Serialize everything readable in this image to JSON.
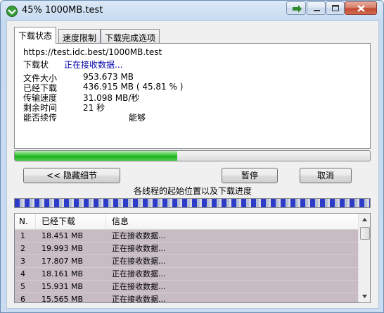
{
  "window": {
    "title": "45% 1000MB.test"
  },
  "tabs": [
    {
      "label": "下载状态"
    },
    {
      "label": "速度限制"
    },
    {
      "label": "下载完成选项"
    }
  ],
  "status_panel": {
    "url": "https://test.idc.best/1000MB.test",
    "status_label": "下载状",
    "status_value": "正在接收数据...",
    "rows": [
      {
        "label": "文件大小",
        "value": "953.673  MB"
      },
      {
        "label": "已经下载",
        "value": "436.915  MB  ( 45.81 % )"
      },
      {
        "label": "传输速度",
        "value": "31.098  MB/秒"
      },
      {
        "label": "剩余时间",
        "value": "21 秒"
      },
      {
        "label": "能否续传",
        "value": "能够"
      }
    ]
  },
  "progress": {
    "percent": 45.81
  },
  "buttons": {
    "hide_details": "<< 隐藏细节",
    "pause": "暂停",
    "cancel": "取消"
  },
  "threads_label": "各线程的起始位置以及下载进度",
  "thread_list": {
    "columns": [
      "N.",
      "已经下载",
      "信息"
    ],
    "rows": [
      {
        "n": "1",
        "downloaded": "18.451 MB",
        "info": "正在接收数据..."
      },
      {
        "n": "2",
        "downloaded": "19.993 MB",
        "info": "正在接收数据..."
      },
      {
        "n": "3",
        "downloaded": "17.807 MB",
        "info": "正在接收数据..."
      },
      {
        "n": "4",
        "downloaded": "18.161 MB",
        "info": "正在接收数据..."
      },
      {
        "n": "5",
        "downloaded": "15.931 MB",
        "info": "正在接收数据..."
      },
      {
        "n": "6",
        "downloaded": "15.565 MB",
        "info": "正在接收数据..."
      }
    ]
  },
  "colors": {
    "progress_fill": "#37c837",
    "status_value": "#0000aa",
    "list_row_bg": "#c8bcc4"
  }
}
